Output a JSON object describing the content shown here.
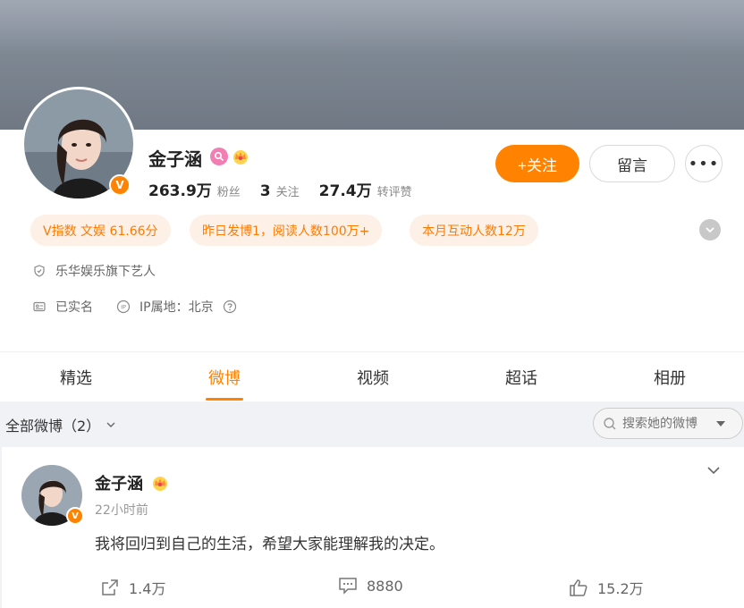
{
  "profile": {
    "name": "金子涵",
    "verified_mark": "V",
    "stats": [
      {
        "value": "263.9万",
        "label": "粉丝"
      },
      {
        "value": "3",
        "label": "关注"
      },
      {
        "value": "27.4万",
        "label": "转评赞"
      }
    ],
    "follow_label": "+关注",
    "message_label": "留言",
    "more_label": "•••",
    "tags": [
      "V指数 文娱 61.66分",
      "昨日发博1，阅读人数100万+",
      "本月互动人数12万"
    ],
    "agency": "乐华娱乐旗下艺人",
    "realname": "已实名",
    "ip_location": "IP属地：北京",
    "badge_icons": [
      "search-badge-icon",
      "crown-icon"
    ]
  },
  "tabs": [
    "精选",
    "微博",
    "视频",
    "超话",
    "相册"
  ],
  "active_tab": "微博",
  "filter": {
    "label": "全部微博（2）",
    "search_placeholder": "搜索她的微博"
  },
  "post": {
    "author": "金子涵",
    "time": "22小时前",
    "text": "我将回归到自己的生活，希望大家能理解我的决定。",
    "reposts": "1.4万",
    "comments": "8880",
    "likes": "15.2万"
  },
  "colors": {
    "accent": "#ff8200",
    "tag_bg": "#fdf0e6",
    "tag_text": "#ff7b00",
    "page_bg": "#f1f2f5"
  }
}
